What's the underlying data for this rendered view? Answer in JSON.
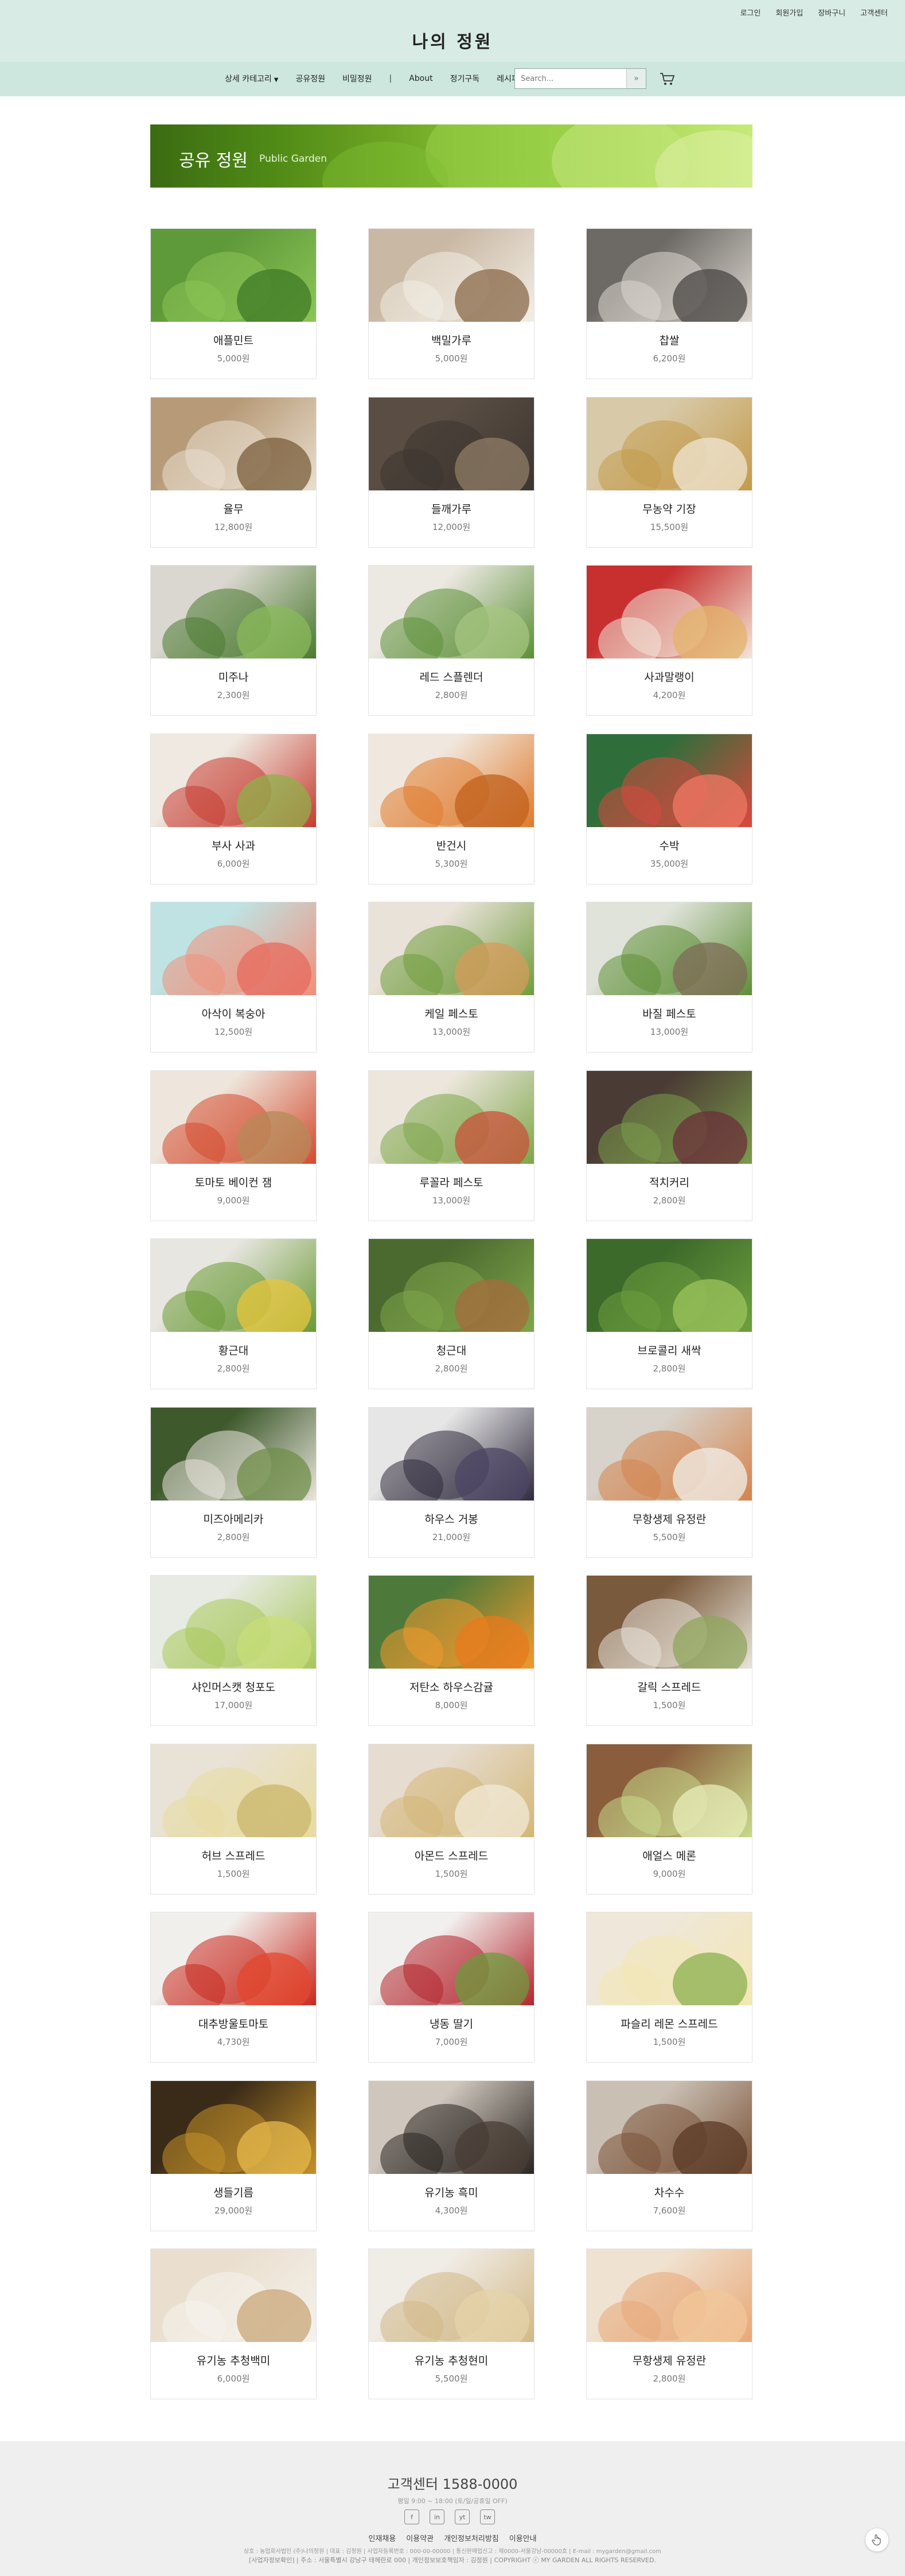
{
  "header": {
    "site_title": "나의 정원",
    "util_links": [
      "로그인",
      "회원가입",
      "장바구니",
      "고객센터"
    ],
    "nav": {
      "category_label": "상세 카테고리",
      "items": [
        "공유정원",
        "비밀정원"
      ],
      "about_label": "About",
      "items2": [
        "정기구독",
        "레시피"
      ],
      "separator": "|"
    },
    "search": {
      "placeholder": "Search...",
      "button_glyph": "»"
    },
    "cart_icon": "cart-icon",
    "bg_color": "#d8ebe5"
  },
  "banner": {
    "title": "공유 정원",
    "subtitle": "Public Garden"
  },
  "products": [
    {
      "name": "애플민트",
      "price": "5,000원"
    },
    {
      "name": "백밀가루",
      "price": "5,000원"
    },
    {
      "name": "찹쌀",
      "price": "6,200원"
    },
    {
      "name": "율무",
      "price": "12,800원"
    },
    {
      "name": "들깨가루",
      "price": "12,000원"
    },
    {
      "name": "무농약 기장",
      "price": "15,500원"
    },
    {
      "name": "미주나",
      "price": "2,300원"
    },
    {
      "name": "레드 스플렌더",
      "price": "2,800원"
    },
    {
      "name": "사과말랭이",
      "price": "4,200원"
    },
    {
      "name": "부사 사과",
      "price": "6,000원"
    },
    {
      "name": "반건시",
      "price": "5,300원"
    },
    {
      "name": "수박",
      "price": "35,000원"
    },
    {
      "name": "아삭이 복숭아",
      "price": "12,500원"
    },
    {
      "name": "케일 페스토",
      "price": "13,000원"
    },
    {
      "name": "바질 페스토",
      "price": "13,000원"
    },
    {
      "name": "토마토 베이컨 잼",
      "price": "9,000원"
    },
    {
      "name": "루꼴라 페스토",
      "price": "13,000원"
    },
    {
      "name": "적치커리",
      "price": "2,800원"
    },
    {
      "name": "황근대",
      "price": "2,800원"
    },
    {
      "name": "청근대",
      "price": "2,800원"
    },
    {
      "name": "브로콜리 새싹",
      "price": "2,800원"
    },
    {
      "name": "미즈아메리카",
      "price": "2,800원"
    },
    {
      "name": "하우스 거봉",
      "price": "21,000원"
    },
    {
      "name": "무항생제 유정란",
      "price": "5,500원"
    },
    {
      "name": "샤인머스캣 청포도",
      "price": "17,000원"
    },
    {
      "name": "저탄소 하우스감귤",
      "price": "8,000원"
    },
    {
      "name": "갈릭 스프레드",
      "price": "1,500원"
    },
    {
      "name": "허브 스프레드",
      "price": "1,500원"
    },
    {
      "name": "아몬드 스프레드",
      "price": "1,500원"
    },
    {
      "name": "애얼스 메론",
      "price": "9,000원"
    },
    {
      "name": "대추방울토마토",
      "price": "4,730원"
    },
    {
      "name": "냉동 딸기",
      "price": "7,000원"
    },
    {
      "name": "파슬리 레몬 스프레드",
      "price": "1,500원"
    },
    {
      "name": "생들기름",
      "price": "29,000원"
    },
    {
      "name": "유기농 흑미",
      "price": "4,300원"
    },
    {
      "name": "차수수",
      "price": "7,600원"
    },
    {
      "name": "유기농 추청백미",
      "price": "6,000원"
    },
    {
      "name": "유기농 추청현미",
      "price": "5,500원"
    },
    {
      "name": "무항생제 유정란",
      "price": "2,800원"
    }
  ],
  "footer": {
    "cs_title": "고객센터 1588-0000",
    "hours": "평일 9:00 ~ 18:00 (토/일/공휴일 OFF)",
    "sns": [
      "f",
      "in",
      "yt",
      "tw"
    ],
    "links": [
      "인재채용",
      "이용약관",
      "개인정보처리방침",
      "이용안내"
    ],
    "address": "상호 : 농업회사법인 (주)나의정원 | 대표 : 김정원 | 사업자등록번호 : 000-00-00000 | 통신판매업신고 : 제0000-서울강남-00000호 | E-mail : mygarden@gmail.com",
    "address2": "[사업자정보확인] | 주소 : 서울특별시 강남구 테헤란로 000 | 개인정보보호책임자 : 김정원 | COPYRIGHT ⓒ MY GARDEN ALL RIGHTS RESERVED."
  }
}
